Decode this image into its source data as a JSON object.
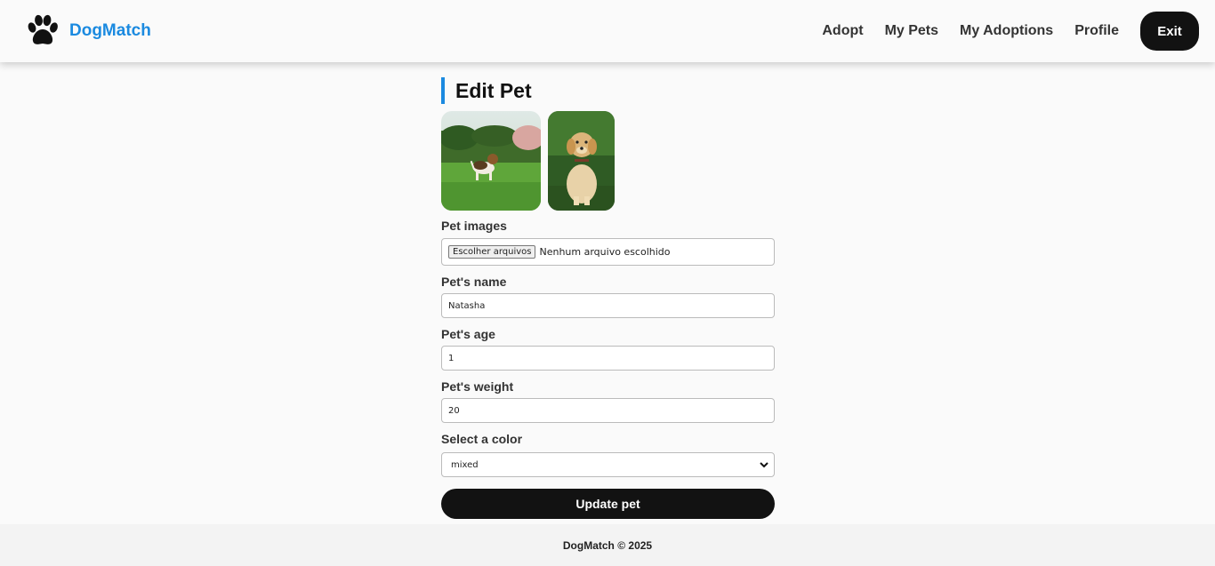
{
  "brand": {
    "name": "DogMatch",
    "color": "#1b8ae0",
    "icon": "paw-icon"
  },
  "nav": {
    "links": [
      "Adopt",
      "My Pets",
      "My Adoptions",
      "Profile"
    ],
    "exit_label": "Exit"
  },
  "page": {
    "title": "Edit Pet",
    "accent": "#1b8ae0"
  },
  "images": [
    {
      "alt": "beagle-on-grass-photo"
    },
    {
      "alt": "golden-puppy-sitting-photo"
    }
  ],
  "form": {
    "images_label": "Pet images",
    "file_button": "Escolher arquivos",
    "file_status": "Nenhum arquivo escolhido",
    "name_label": "Pet's name",
    "name_value": "Natasha",
    "age_label": "Pet's age",
    "age_value": "1",
    "weight_label": "Pet's weight",
    "weight_value": "20",
    "color_label": "Select a color",
    "color_value": "mixed",
    "submit_label": "Update pet"
  },
  "footer": {
    "text": "DogMatch © 2025"
  }
}
